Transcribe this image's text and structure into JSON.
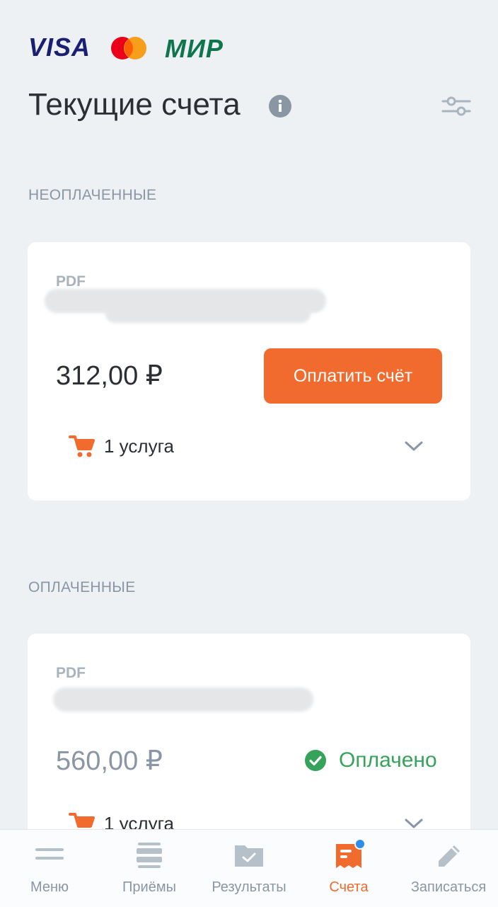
{
  "payment_logos": {
    "visa": "VISA",
    "mir": "МИР"
  },
  "header": {
    "title": "Текущие счета"
  },
  "sections": {
    "unpaid": {
      "label": "НЕОПЛАЧЕННЫЕ",
      "invoice": {
        "doc_type": "PDF",
        "amount": "312,00 ₽",
        "pay_button": "Оплатить счёт",
        "services": "1 услуга"
      }
    },
    "paid": {
      "label": "ОПЛАЧЕННЫЕ",
      "invoice": {
        "doc_type": "PDF",
        "amount": "560,00 ₽",
        "status": "Оплачено",
        "services": "1 услуга"
      }
    }
  },
  "bottom_nav": [
    {
      "label": "Меню",
      "icon": "menu-icon"
    },
    {
      "label": "Приёмы",
      "icon": "appointments-icon"
    },
    {
      "label": "Результаты",
      "icon": "results-folder-icon"
    },
    {
      "label": "Счета",
      "icon": "invoices-icon",
      "active": true,
      "badge": true
    },
    {
      "label": "Записаться",
      "icon": "pencil-icon"
    }
  ],
  "colors": {
    "accent": "#f26b2e",
    "background": "#edf1f4",
    "paid_green": "#36a35a",
    "muted": "#8a96a3",
    "badge_blue": "#2f8ce8"
  }
}
